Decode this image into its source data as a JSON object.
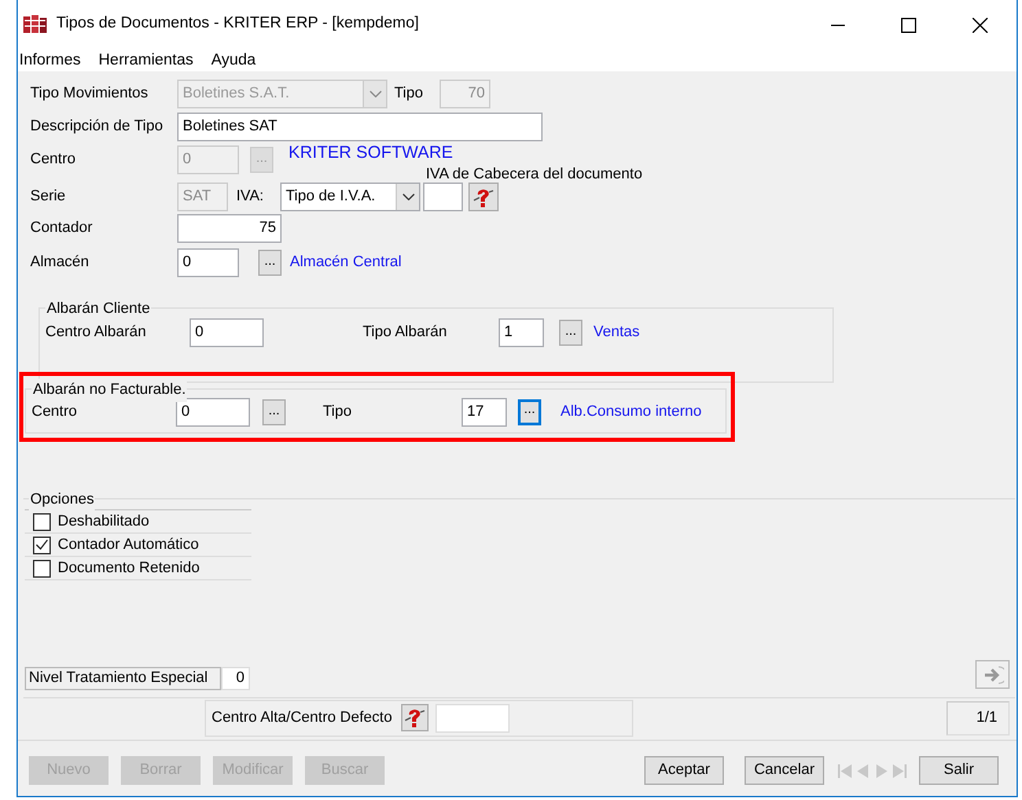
{
  "window": {
    "title": "Tipos de Documentos - KRITER ERP - [kempdemo]"
  },
  "menu": [
    "Informes",
    "Herramientas",
    "Ayuda"
  ],
  "header": {
    "tipo_movimientos": {
      "label": "Tipo Movimientos",
      "value": "Boletines S.A.T.",
      "disabled": true
    },
    "tipo": {
      "label": "Tipo",
      "value": "70",
      "disabled": true
    },
    "descripcion": {
      "label": "Descripción de Tipo",
      "value": "Boletines SAT"
    },
    "centro": {
      "label": "Centro",
      "value": "0",
      "disabled": true,
      "button": "...",
      "name": "KRITER SOFTWARE"
    },
    "serie": {
      "label": "Serie",
      "value": "SAT",
      "disabled": true
    },
    "iva": {
      "label": "IVA:",
      "value": "Tipo de I.V.A."
    },
    "iva_cabecera": {
      "label": "IVA de Cabecera del documento"
    },
    "contador": {
      "label": "Contador",
      "value": "75"
    },
    "almacen": {
      "label": "Almacén",
      "value": "0",
      "button": "...",
      "name": "Almacén Central"
    }
  },
  "albaran_cliente": {
    "title": "Albarán Cliente",
    "highlighted": false,
    "centro": {
      "label": "Centro Albarán",
      "value": "0"
    },
    "tipo": {
      "label": "Tipo Albarán",
      "value": "1",
      "button": "...",
      "name": "Ventas",
      "focused": false
    }
  },
  "albaran_no_facturable": {
    "title": "Albarán no Facturable.",
    "highlighted": true,
    "centro": {
      "label": "Centro",
      "value": "0",
      "button": "..."
    },
    "tipo": {
      "label": "Tipo",
      "value": "17",
      "button": "...",
      "name": "Alb.Consumo interno",
      "focused": true
    }
  },
  "opciones": {
    "title": "Opciones",
    "items": [
      {
        "label": "Deshabilitado",
        "checked": false
      },
      {
        "label": "Contador Automático",
        "checked": true
      },
      {
        "label": "Documento Retenido",
        "checked": false
      }
    ]
  },
  "nivel": {
    "label": "Nivel Tratamiento Especial",
    "value": "0"
  },
  "centro_alta": {
    "label": "Centro Alta/Centro Defecto"
  },
  "record_counter": "1/1",
  "left_buttons": [
    {
      "label": "Nuevo",
      "disabled": true
    },
    {
      "label": "Borrar",
      "disabled": true
    },
    {
      "label": "Modificar",
      "disabled": true
    },
    {
      "label": "Buscar",
      "disabled": true
    }
  ],
  "right_buttons": [
    {
      "label": "Aceptar",
      "disabled": false
    },
    {
      "label": "Cancelar",
      "disabled": false
    }
  ],
  "navigation": {
    "disabled": true
  },
  "exit_button": {
    "label": "Salir",
    "disabled": false
  }
}
